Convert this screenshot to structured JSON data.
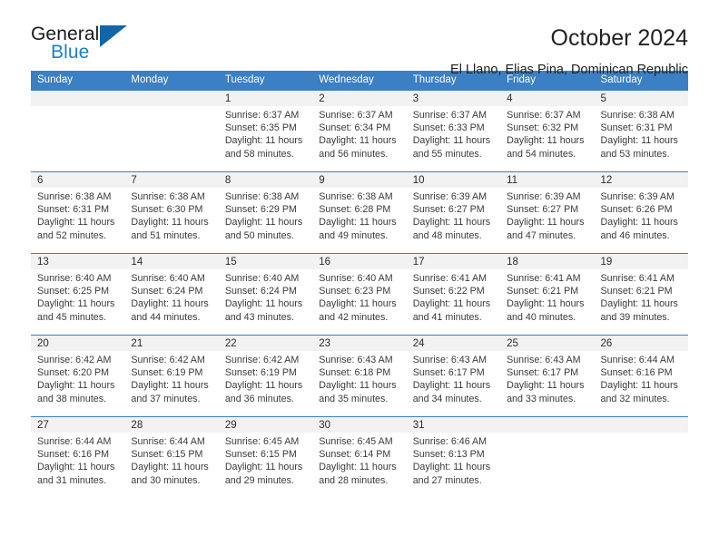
{
  "brand": {
    "name_part1": "General",
    "name_part2": "Blue",
    "triangle_icon": "brand-triangle-icon",
    "accent_color": "#1266a8",
    "blue_text_color": "#1f7ec4"
  },
  "header": {
    "title": "October 2024",
    "subtitle": "El Llano, Elias Pina, Dominican Republic"
  },
  "theme": {
    "header_row_bg": "#3b7fc4",
    "date_band_bg": "#f2f2f2",
    "row_border": "#3b7fc4",
    "text": "#3a3a3a"
  },
  "weekday_headers": [
    "Sunday",
    "Monday",
    "Tuesday",
    "Wednesday",
    "Thursday",
    "Friday",
    "Saturday"
  ],
  "weeks": [
    [
      {
        "date": "",
        "empty": true,
        "sunrise": "",
        "sunset": "",
        "daylight_line1": "",
        "daylight_line2": ""
      },
      {
        "date": "",
        "empty": true,
        "sunrise": "",
        "sunset": "",
        "daylight_line1": "",
        "daylight_line2": ""
      },
      {
        "date": "1",
        "empty": false,
        "sunrise": "Sunrise: 6:37 AM",
        "sunset": "Sunset: 6:35 PM",
        "daylight_line1": "Daylight: 11 hours",
        "daylight_line2": "and 58 minutes."
      },
      {
        "date": "2",
        "empty": false,
        "sunrise": "Sunrise: 6:37 AM",
        "sunset": "Sunset: 6:34 PM",
        "daylight_line1": "Daylight: 11 hours",
        "daylight_line2": "and 56 minutes."
      },
      {
        "date": "3",
        "empty": false,
        "sunrise": "Sunrise: 6:37 AM",
        "sunset": "Sunset: 6:33 PM",
        "daylight_line1": "Daylight: 11 hours",
        "daylight_line2": "and 55 minutes."
      },
      {
        "date": "4",
        "empty": false,
        "sunrise": "Sunrise: 6:37 AM",
        "sunset": "Sunset: 6:32 PM",
        "daylight_line1": "Daylight: 11 hours",
        "daylight_line2": "and 54 minutes."
      },
      {
        "date": "5",
        "empty": false,
        "sunrise": "Sunrise: 6:38 AM",
        "sunset": "Sunset: 6:31 PM",
        "daylight_line1": "Daylight: 11 hours",
        "daylight_line2": "and 53 minutes."
      }
    ],
    [
      {
        "date": "6",
        "empty": false,
        "sunrise": "Sunrise: 6:38 AM",
        "sunset": "Sunset: 6:31 PM",
        "daylight_line1": "Daylight: 11 hours",
        "daylight_line2": "and 52 minutes."
      },
      {
        "date": "7",
        "empty": false,
        "sunrise": "Sunrise: 6:38 AM",
        "sunset": "Sunset: 6:30 PM",
        "daylight_line1": "Daylight: 11 hours",
        "daylight_line2": "and 51 minutes."
      },
      {
        "date": "8",
        "empty": false,
        "sunrise": "Sunrise: 6:38 AM",
        "sunset": "Sunset: 6:29 PM",
        "daylight_line1": "Daylight: 11 hours",
        "daylight_line2": "and 50 minutes."
      },
      {
        "date": "9",
        "empty": false,
        "sunrise": "Sunrise: 6:38 AM",
        "sunset": "Sunset: 6:28 PM",
        "daylight_line1": "Daylight: 11 hours",
        "daylight_line2": "and 49 minutes."
      },
      {
        "date": "10",
        "empty": false,
        "sunrise": "Sunrise: 6:39 AM",
        "sunset": "Sunset: 6:27 PM",
        "daylight_line1": "Daylight: 11 hours",
        "daylight_line2": "and 48 minutes."
      },
      {
        "date": "11",
        "empty": false,
        "sunrise": "Sunrise: 6:39 AM",
        "sunset": "Sunset: 6:27 PM",
        "daylight_line1": "Daylight: 11 hours",
        "daylight_line2": "and 47 minutes."
      },
      {
        "date": "12",
        "empty": false,
        "sunrise": "Sunrise: 6:39 AM",
        "sunset": "Sunset: 6:26 PM",
        "daylight_line1": "Daylight: 11 hours",
        "daylight_line2": "and 46 minutes."
      }
    ],
    [
      {
        "date": "13",
        "empty": false,
        "sunrise": "Sunrise: 6:40 AM",
        "sunset": "Sunset: 6:25 PM",
        "daylight_line1": "Daylight: 11 hours",
        "daylight_line2": "and 45 minutes."
      },
      {
        "date": "14",
        "empty": false,
        "sunrise": "Sunrise: 6:40 AM",
        "sunset": "Sunset: 6:24 PM",
        "daylight_line1": "Daylight: 11 hours",
        "daylight_line2": "and 44 minutes."
      },
      {
        "date": "15",
        "empty": false,
        "sunrise": "Sunrise: 6:40 AM",
        "sunset": "Sunset: 6:24 PM",
        "daylight_line1": "Daylight: 11 hours",
        "daylight_line2": "and 43 minutes."
      },
      {
        "date": "16",
        "empty": false,
        "sunrise": "Sunrise: 6:40 AM",
        "sunset": "Sunset: 6:23 PM",
        "daylight_line1": "Daylight: 11 hours",
        "daylight_line2": "and 42 minutes."
      },
      {
        "date": "17",
        "empty": false,
        "sunrise": "Sunrise: 6:41 AM",
        "sunset": "Sunset: 6:22 PM",
        "daylight_line1": "Daylight: 11 hours",
        "daylight_line2": "and 41 minutes."
      },
      {
        "date": "18",
        "empty": false,
        "sunrise": "Sunrise: 6:41 AM",
        "sunset": "Sunset: 6:21 PM",
        "daylight_line1": "Daylight: 11 hours",
        "daylight_line2": "and 40 minutes."
      },
      {
        "date": "19",
        "empty": false,
        "sunrise": "Sunrise: 6:41 AM",
        "sunset": "Sunset: 6:21 PM",
        "daylight_line1": "Daylight: 11 hours",
        "daylight_line2": "and 39 minutes."
      }
    ],
    [
      {
        "date": "20",
        "empty": false,
        "sunrise": "Sunrise: 6:42 AM",
        "sunset": "Sunset: 6:20 PM",
        "daylight_line1": "Daylight: 11 hours",
        "daylight_line2": "and 38 minutes."
      },
      {
        "date": "21",
        "empty": false,
        "sunrise": "Sunrise: 6:42 AM",
        "sunset": "Sunset: 6:19 PM",
        "daylight_line1": "Daylight: 11 hours",
        "daylight_line2": "and 37 minutes."
      },
      {
        "date": "22",
        "empty": false,
        "sunrise": "Sunrise: 6:42 AM",
        "sunset": "Sunset: 6:19 PM",
        "daylight_line1": "Daylight: 11 hours",
        "daylight_line2": "and 36 minutes."
      },
      {
        "date": "23",
        "empty": false,
        "sunrise": "Sunrise: 6:43 AM",
        "sunset": "Sunset: 6:18 PM",
        "daylight_line1": "Daylight: 11 hours",
        "daylight_line2": "and 35 minutes."
      },
      {
        "date": "24",
        "empty": false,
        "sunrise": "Sunrise: 6:43 AM",
        "sunset": "Sunset: 6:17 PM",
        "daylight_line1": "Daylight: 11 hours",
        "daylight_line2": "and 34 minutes."
      },
      {
        "date": "25",
        "empty": false,
        "sunrise": "Sunrise: 6:43 AM",
        "sunset": "Sunset: 6:17 PM",
        "daylight_line1": "Daylight: 11 hours",
        "daylight_line2": "and 33 minutes."
      },
      {
        "date": "26",
        "empty": false,
        "sunrise": "Sunrise: 6:44 AM",
        "sunset": "Sunset: 6:16 PM",
        "daylight_line1": "Daylight: 11 hours",
        "daylight_line2": "and 32 minutes."
      }
    ],
    [
      {
        "date": "27",
        "empty": false,
        "sunrise": "Sunrise: 6:44 AM",
        "sunset": "Sunset: 6:16 PM",
        "daylight_line1": "Daylight: 11 hours",
        "daylight_line2": "and 31 minutes."
      },
      {
        "date": "28",
        "empty": false,
        "sunrise": "Sunrise: 6:44 AM",
        "sunset": "Sunset: 6:15 PM",
        "daylight_line1": "Daylight: 11 hours",
        "daylight_line2": "and 30 minutes."
      },
      {
        "date": "29",
        "empty": false,
        "sunrise": "Sunrise: 6:45 AM",
        "sunset": "Sunset: 6:15 PM",
        "daylight_line1": "Daylight: 11 hours",
        "daylight_line2": "and 29 minutes."
      },
      {
        "date": "30",
        "empty": false,
        "sunrise": "Sunrise: 6:45 AM",
        "sunset": "Sunset: 6:14 PM",
        "daylight_line1": "Daylight: 11 hours",
        "daylight_line2": "and 28 minutes."
      },
      {
        "date": "31",
        "empty": false,
        "sunrise": "Sunrise: 6:46 AM",
        "sunset": "Sunset: 6:13 PM",
        "daylight_line1": "Daylight: 11 hours",
        "daylight_line2": "and 27 minutes."
      },
      {
        "date": "",
        "empty": true,
        "sunrise": "",
        "sunset": "",
        "daylight_line1": "",
        "daylight_line2": ""
      },
      {
        "date": "",
        "empty": true,
        "sunrise": "",
        "sunset": "",
        "daylight_line1": "",
        "daylight_line2": ""
      }
    ]
  ]
}
